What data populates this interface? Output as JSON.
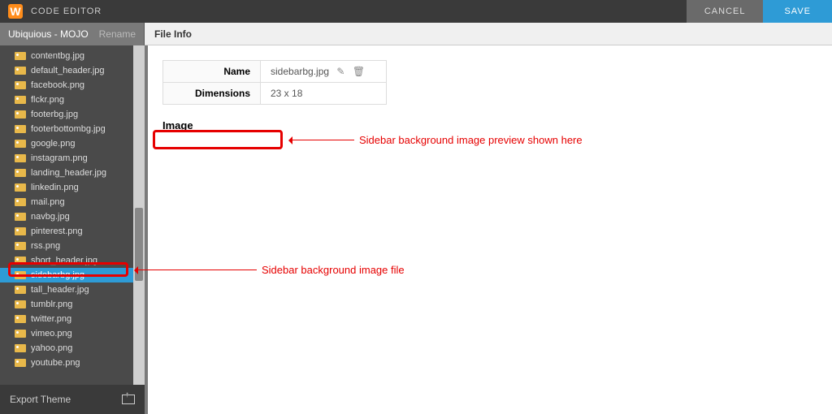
{
  "topbar": {
    "title": "CODE EDITOR",
    "cancel": "CANCEL",
    "save": "SAVE"
  },
  "subheader": {
    "theme": "Ubiquious - MOJO",
    "rename": "Rename",
    "panel": "File Info"
  },
  "files": [
    "contentbg.jpg",
    "default_header.jpg",
    "facebook.png",
    "flckr.png",
    "footerbg.jpg",
    "footerbottombg.jpg",
    "google.png",
    "instagram.png",
    "landing_header.jpg",
    "linkedin.png",
    "mail.png",
    "navbg.jpg",
    "pinterest.png",
    "rss.png",
    "short_header.jpg",
    "sidebarbg.jpg",
    "tall_header.jpg",
    "tumblr.png",
    "twitter.png",
    "vimeo.png",
    "yahoo.png",
    "youtube.png"
  ],
  "selected": "sidebarbg.jpg",
  "export": "Export Theme",
  "info": {
    "name_label": "Name",
    "name_value": "sidebarbg.jpg",
    "dim_label": "Dimensions",
    "dim_value": "23 x 18"
  },
  "image_label": "Image",
  "annotation": {
    "preview": "Sidebar background image preview shown  here",
    "file": "Sidebar background image file"
  }
}
